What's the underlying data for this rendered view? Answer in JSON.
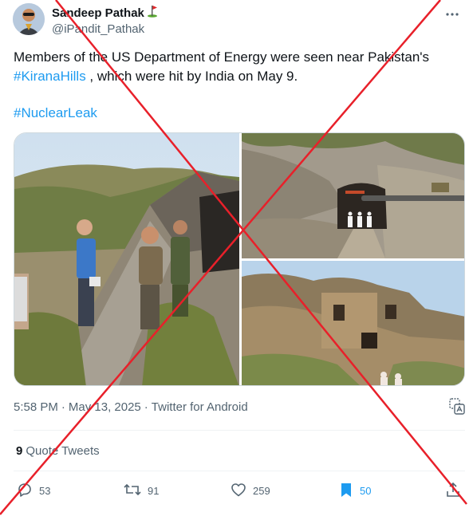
{
  "user": {
    "display_name": "Sandeep Pathak",
    "handle": "@iPandit_Pathak",
    "name_emoji": "⛳"
  },
  "tweet": {
    "text_before": "Members of the US Department of Energy were seen near Pakistan's ",
    "hashtag_kirana": "#KiranaHills",
    "text_after": " , which were hit by India on May 9.",
    "hashtag_leak": "#NuclearLeak"
  },
  "meta": {
    "time": "5:58 PM",
    "separator": "·",
    "date": "May 13, 2025",
    "source": "Twitter for Android"
  },
  "quote_tweets": {
    "count": "9",
    "label": "Quote Tweets"
  },
  "actions": {
    "reply_count": "53",
    "retweet_count": "91",
    "like_count": "259",
    "bookmark_count": "50"
  },
  "colors": {
    "accent": "#1d9bf0",
    "cross": "#e8202a",
    "text": "#0f1419",
    "secondary": "#536471"
  },
  "icons": {
    "more": "more-icon",
    "translate": "translate-icon",
    "reply": "reply-icon",
    "retweet": "retweet-icon",
    "like": "heart-icon",
    "bookmark": "bookmark-icon",
    "share": "share-icon"
  }
}
